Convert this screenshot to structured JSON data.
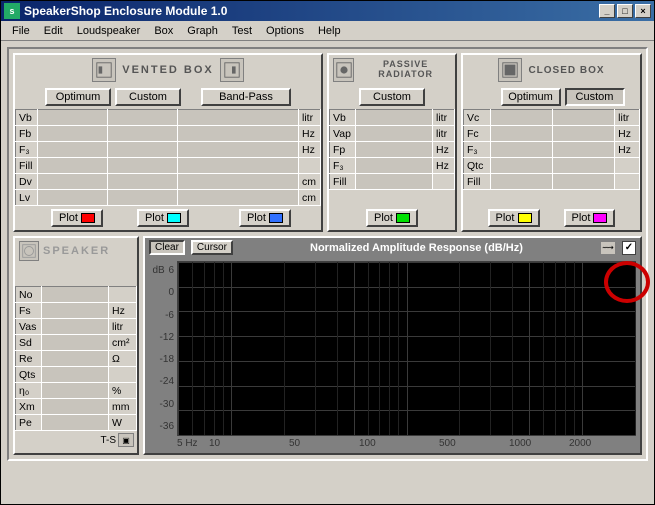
{
  "window": {
    "title": "SpeakerShop Enclosure Module 1.0",
    "min": "_",
    "max": "□",
    "close": "×"
  },
  "menu": [
    "File",
    "Edit",
    "Loudspeaker",
    "Box",
    "Graph",
    "Test",
    "Options",
    "Help"
  ],
  "vented": {
    "title": "VENTED  BOX",
    "optimum": "Optimum",
    "custom": "Custom",
    "bandpass": "Band-Pass",
    "rows": [
      "Vb",
      "Fb",
      "F₃",
      "Fill",
      "Dv",
      "Lv"
    ],
    "units": [
      "litr",
      "Hz",
      "Hz",
      "",
      "cm",
      "cm"
    ],
    "plot": "Plot",
    "swatches": {
      "optimum": "#ff0000",
      "custom": "#00ffff",
      "bandpass": "#3070ff"
    }
  },
  "passive": {
    "title": "PASSIVE RADIATOR",
    "custom": "Custom",
    "rows": [
      "Vb",
      "Vap",
      "Fp",
      "F₃",
      "Fill"
    ],
    "units": [
      "litr",
      "litr",
      "Hz",
      "Hz",
      ""
    ],
    "plot": "Plot",
    "swatch": "#00e000"
  },
  "closed": {
    "title": "CLOSED BOX",
    "optimum": "Optimum",
    "custom": "Custom",
    "rows": [
      "Vc",
      "Fc",
      "F₃",
      "Qtc",
      "Fill"
    ],
    "units": [
      "litr",
      "Hz",
      "Hz",
      "",
      ""
    ],
    "plot": "Plot",
    "swatches": {
      "optimum": "#ffff00",
      "custom": "#ff00ff"
    }
  },
  "speaker": {
    "title": "SPEAKER",
    "rows": [
      "No",
      "Fs",
      "Vas",
      "Sd",
      "Re",
      "Qts",
      "η₀",
      "Xm",
      "Pe"
    ],
    "units": [
      "",
      "Hz",
      "litr",
      "cm²",
      "Ω",
      "",
      "%",
      "mm",
      "W"
    ],
    "ts": "T-S"
  },
  "graph": {
    "clear": "Clear",
    "cursor": "Cursor",
    "title": "Normalized Amplitude Response (dB/Hz)",
    "checkbox_checked": "✓",
    "chart_data": {
      "type": "line",
      "series": [],
      "ylabel": "dB",
      "xlabel": "Hz",
      "ylim": [
        -36,
        6
      ],
      "xlim": [
        5,
        2000
      ],
      "xscale": "log",
      "x_ticks": [
        5,
        10,
        50,
        100,
        500,
        1000,
        2000
      ],
      "x_tick_labels": [
        "5 Hz",
        "10",
        "50",
        "100",
        "500",
        "1000",
        "2000"
      ],
      "y_ticks": [
        6,
        0,
        -6,
        -12,
        -18,
        -24,
        -30,
        -36
      ]
    }
  }
}
